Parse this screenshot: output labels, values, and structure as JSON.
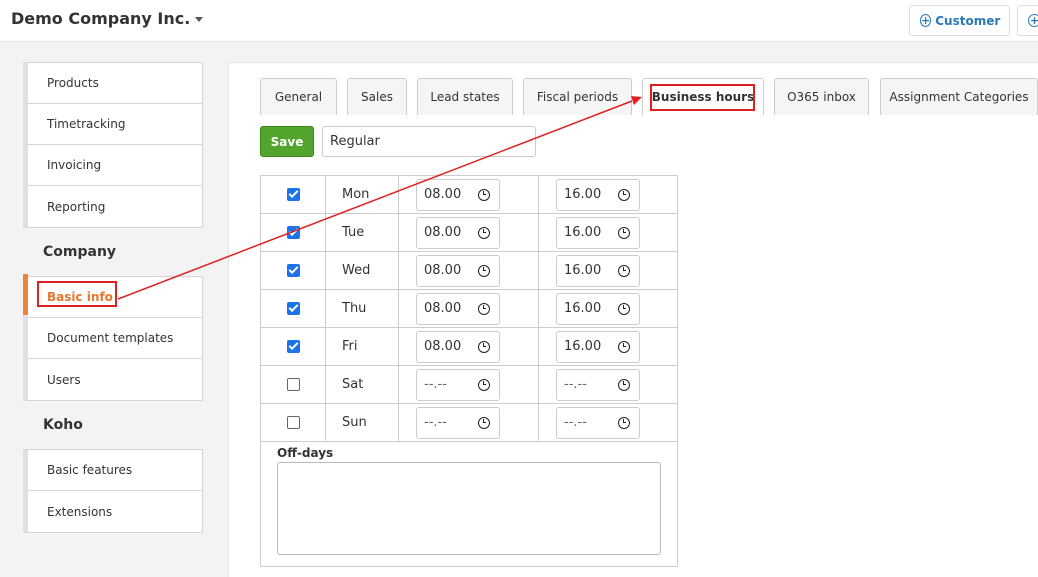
{
  "header": {
    "company_name": "Demo Company Inc.",
    "customer_button": "Customer"
  },
  "sidebar": {
    "group1": [
      "Products",
      "Timetracking",
      "Invoicing",
      "Reporting"
    ],
    "company_heading": "Company",
    "group2": [
      "Basic info",
      "Document templates",
      "Users"
    ],
    "koho_heading": "Koho",
    "group3": [
      "Basic features",
      "Extensions"
    ]
  },
  "tabs": [
    "General",
    "Sales",
    "Lead states",
    "Fiscal periods",
    "Business hours",
    "O365 inbox",
    "Assignment Categories"
  ],
  "active_tab": "Business hours",
  "form": {
    "save_label": "Save",
    "name_value": "Regular"
  },
  "hours": [
    {
      "day": "Mon",
      "checked": true,
      "start": "08.00",
      "end": "16.00"
    },
    {
      "day": "Tue",
      "checked": true,
      "start": "08.00",
      "end": "16.00"
    },
    {
      "day": "Wed",
      "checked": true,
      "start": "08.00",
      "end": "16.00"
    },
    {
      "day": "Thu",
      "checked": true,
      "start": "08.00",
      "end": "16.00"
    },
    {
      "day": "Fri",
      "checked": true,
      "start": "08.00",
      "end": "16.00"
    },
    {
      "day": "Sat",
      "checked": false,
      "start": "--.--",
      "end": "--.--"
    },
    {
      "day": "Sun",
      "checked": false,
      "start": "--.--",
      "end": "--.--"
    }
  ],
  "offdays_label": "Off-days",
  "colors": {
    "accent": "#2a7ab8",
    "active": "#e8772e",
    "save": "#52a42c",
    "annotation": "#e02020"
  }
}
